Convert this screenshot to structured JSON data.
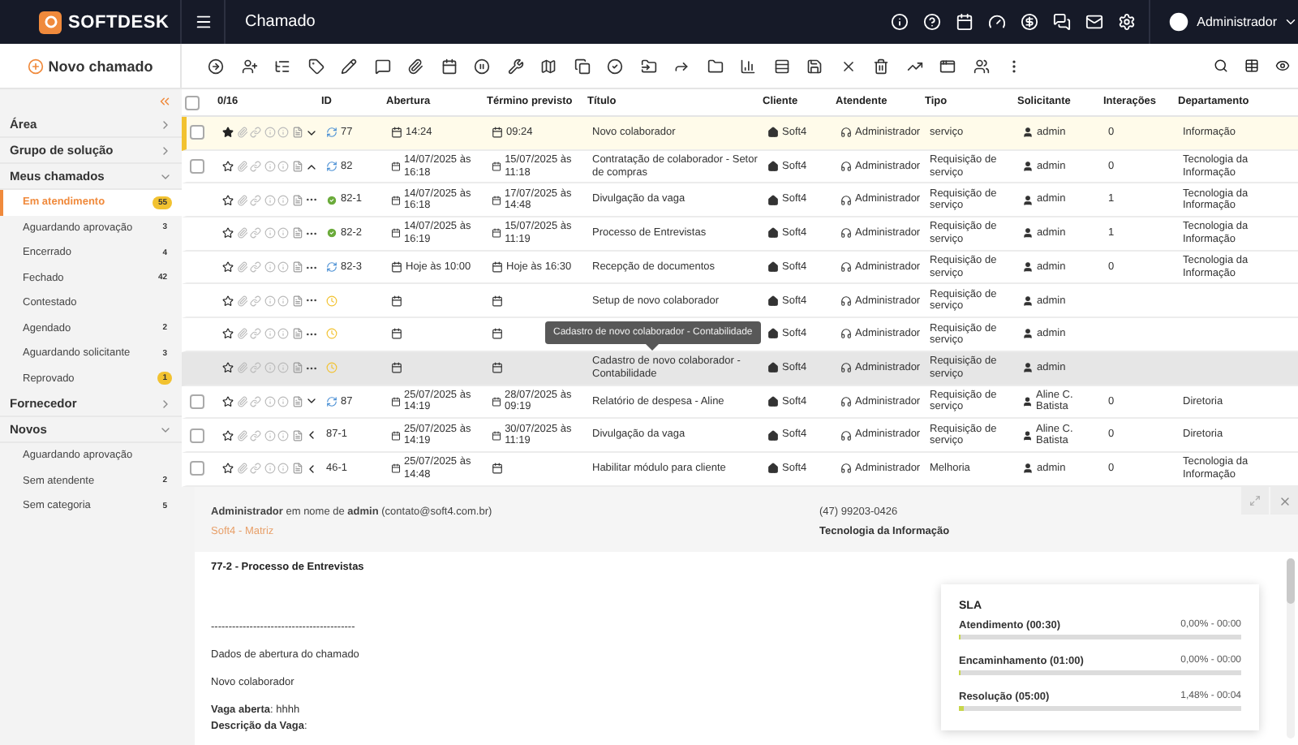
{
  "header": {
    "brand": "SOFTDESK",
    "title": "Chamado",
    "user": "Administrador"
  },
  "new_ticket": "Novo chamado",
  "sidebar": {
    "groups": [
      {
        "label": "Área",
        "expanded": false
      },
      {
        "label": "Grupo de solução",
        "expanded": false
      },
      {
        "label": "Meus chamados",
        "expanded": true,
        "items": [
          {
            "label": "Em atendimento",
            "count": "55",
            "alert": true,
            "selected": true
          },
          {
            "label": "Aguardando aprovação",
            "count": "3",
            "alert": false,
            "selected": false
          },
          {
            "label": "Encerrado",
            "count": "4",
            "alert": false,
            "selected": false
          },
          {
            "label": "Fechado",
            "count": "42",
            "alert": false,
            "selected": false
          },
          {
            "label": "Contestado",
            "selected": false
          },
          {
            "label": "Agendado",
            "count": "2",
            "alert": false,
            "selected": false
          },
          {
            "label": "Aguardando solicitante",
            "count": "3",
            "alert": false,
            "selected": false
          },
          {
            "label": "Reprovado",
            "count": "1",
            "alert": true,
            "selected": false
          }
        ]
      },
      {
        "label": "Fornecedor",
        "expanded": false
      },
      {
        "label": "Novos",
        "expanded": true,
        "items": [
          {
            "label": "Aguardando aprovação",
            "selected": false
          },
          {
            "label": "Sem atendente",
            "count": "2",
            "alert": false,
            "selected": false
          },
          {
            "label": "Sem categoria",
            "count": "5",
            "alert": false,
            "selected": false
          }
        ]
      }
    ]
  },
  "table": {
    "selection": "0/16",
    "all_checked": false,
    "columns": [
      "ID",
      "Abertura",
      "Término previsto",
      "Título",
      "Cliente",
      "Atendente",
      "Tipo",
      "Solicitante",
      "Interações",
      "Departamento"
    ],
    "rows": [
      {
        "kind": "parent",
        "checked": false,
        "starred": true,
        "expanded": false,
        "done": false,
        "pending": false,
        "id": "77",
        "opened": "14:24",
        "due": "09:24",
        "title": "Novo colaborador",
        "client": "Soft4",
        "agent": "Administrador",
        "type": "serviço",
        "requester": "admin",
        "interactions": "0",
        "department": "Informação",
        "selected": true,
        "highlighted": false
      },
      {
        "kind": "parent",
        "checked": false,
        "starred": false,
        "expanded": true,
        "done": false,
        "pending": false,
        "id": "82",
        "opened": "14/07/2025 às 16:18",
        "due": "15/07/2025 às 11:18",
        "title": "Contratação de colaborador - Setor de compras",
        "client": "Soft4",
        "agent": "Administrador",
        "type": "Requisição de serviço",
        "requester": "admin",
        "interactions": "0",
        "department": "Tecnologia da Informação",
        "selected": false,
        "highlighted": false
      },
      {
        "kind": "child",
        "starred": false,
        "done": true,
        "pending": false,
        "id": "82-1",
        "opened": "14/07/2025 às 16:18",
        "due": "17/07/2025 às 14:48",
        "title": "Divulgação da vaga",
        "client": "Soft4",
        "agent": "Administrador",
        "type": "Requisição de serviço",
        "requester": "admin",
        "interactions": "1",
        "department": "Tecnologia da Informação",
        "selected": false,
        "highlighted": false
      },
      {
        "kind": "child",
        "starred": false,
        "done": true,
        "pending": false,
        "id": "82-2",
        "opened": "14/07/2025 às 16:19",
        "due": "15/07/2025 às 11:19",
        "title": "Processo de Entrevistas",
        "client": "Soft4",
        "agent": "Administrador",
        "type": "Requisição de serviço",
        "requester": "admin",
        "interactions": "1",
        "department": "Tecnologia da Informação",
        "selected": false,
        "highlighted": false
      },
      {
        "kind": "child",
        "starred": false,
        "done": false,
        "pending": false,
        "id": "82-3",
        "opened": "Hoje às 10:00",
        "due": "Hoje às 16:30",
        "title": "Recepção de documentos",
        "client": "Soft4",
        "agent": "Administrador",
        "type": "Requisição de serviço",
        "requester": "admin",
        "interactions": "0",
        "department": "Tecnologia da Informação",
        "selected": false,
        "highlighted": false
      },
      {
        "kind": "child",
        "starred": false,
        "done": false,
        "pending": true,
        "title": "Setup de novo colaborador",
        "client": "Soft4",
        "agent": "Administrador",
        "type": "Requisição de serviço",
        "requester": "admin",
        "selected": false,
        "highlighted": false
      },
      {
        "kind": "child",
        "starred": false,
        "done": false,
        "pending": true,
        "client": "Soft4",
        "agent": "Administrador",
        "type": "Requisição de serviço",
        "requester": "admin",
        "selected": false,
        "highlighted": false
      },
      {
        "kind": "child",
        "starred": false,
        "done": false,
        "pending": true,
        "title": "Cadastro de novo colaborador - Contabilidade",
        "client": "Soft4",
        "agent": "Administrador",
        "type": "Requisição de serviço",
        "requester": "admin",
        "selected": false,
        "highlighted": true
      },
      {
        "kind": "parent",
        "checked": false,
        "starred": false,
        "expanded": false,
        "done": false,
        "pending": false,
        "id": "87",
        "opened": "25/07/2025 às 14:19",
        "due": "28/07/2025 às 09:19",
        "title": "Relatório de despesa - Aline",
        "client": "Soft4",
        "agent": "Administrador",
        "type": "Requisição de serviço",
        "requester": "Aline C. Batista",
        "interactions": "0",
        "department": "Diretoria",
        "selected": false,
        "highlighted": false
      },
      {
        "kind": "linked",
        "checked": false,
        "starred": false,
        "id": "87-1",
        "opened": "25/07/2025 às 14:19",
        "due": "30/07/2025 às 11:19",
        "title": "Divulgação da vaga",
        "client": "Soft4",
        "agent": "Administrador",
        "type": "Requisição de serviço",
        "requester": "Aline C. Batista",
        "interactions": "0",
        "department": "Diretoria",
        "selected": false,
        "highlighted": false
      },
      {
        "kind": "linked",
        "checked": false,
        "starred": false,
        "id": "46-1",
        "opened": "25/07/2025 às 14:48",
        "title": "Habilitar módulo para cliente",
        "client": "Soft4",
        "agent": "Administrador",
        "type": "Melhoria",
        "requester": "admin",
        "interactions": "0",
        "department": "Tecnologia da Informação",
        "selected": false,
        "highlighted": false
      }
    ],
    "tooltip": "Cadastro de novo colaborador - Contabilidade"
  },
  "detail": {
    "requester_line": "**Administrador** em nome de **admin** (contato@soft4.com.br)",
    "company": "Soft4 - Matriz",
    "phone": "(47) 99203-0426",
    "department": "Tecnologia da Informação",
    "heading": "77-2 - Processo de Entrevistas",
    "body": [
      "-----------------------------------------",
      "Dados de abertura do chamado",
      "Novo colaborador"
    ],
    "fields": [
      "**Vaga aberta**: hhhh",
      "**Descrição da Vaga**:"
    ],
    "sla": {
      "title": "SLA",
      "rows": [
        {
          "label": "Atendimento (00:30)",
          "value": "0,00% - 00:00",
          "level": 0
        },
        {
          "label": "Encaminhamento (01:00)",
          "value": "0,00% - 00:00",
          "level": 0
        },
        {
          "label": "Resolução (05:00)",
          "value": "1,48% - 00:04",
          "level": 0.0148
        }
      ]
    }
  }
}
